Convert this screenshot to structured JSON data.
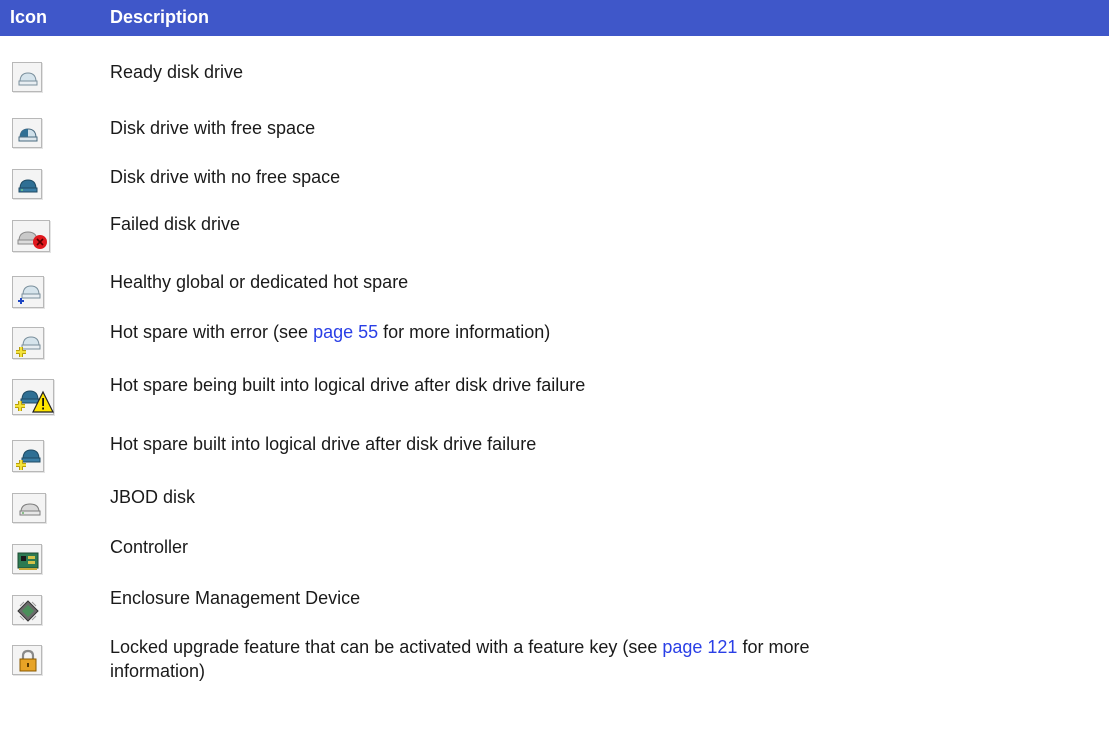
{
  "header": {
    "icon_label": "Icon",
    "description_label": "Description"
  },
  "rows": [
    {
      "icon": "ready-disk-drive-icon",
      "text": "Ready disk drive"
    },
    {
      "icon": "disk-drive-free-space-icon",
      "text": "Disk drive with free space"
    },
    {
      "icon": "disk-drive-no-free-space-icon",
      "text": "Disk drive with no free space"
    },
    {
      "icon": "failed-disk-drive-icon",
      "text": "Failed disk drive"
    },
    {
      "icon": "healthy-hot-spare-icon",
      "text": "Healthy global or dedicated hot spare"
    },
    {
      "icon": "hot-spare-error-icon",
      "text_before": "Hot spare with error (see ",
      "link": "page 55",
      "text_after": " for more information)"
    },
    {
      "icon": "hot-spare-building-icon",
      "text": "Hot spare being built into logical drive after disk drive failure"
    },
    {
      "icon": "hot-spare-built-icon",
      "text": "Hot spare built into logical drive after disk drive failure"
    },
    {
      "icon": "jbod-disk-icon",
      "text": "JBOD disk"
    },
    {
      "icon": "controller-icon",
      "text": "Controller"
    },
    {
      "icon": "enclosure-management-device-icon",
      "text": "Enclosure Management Device"
    },
    {
      "icon": "locked-upgrade-feature-icon",
      "text_before": "Locked upgrade feature that can be activated with a feature key (see ",
      "link": "page 121",
      "text_after": " for more",
      "text_line2": "information)"
    }
  ],
  "colors": {
    "header_bg": "#3f57c9",
    "link": "#2a3fe6"
  }
}
